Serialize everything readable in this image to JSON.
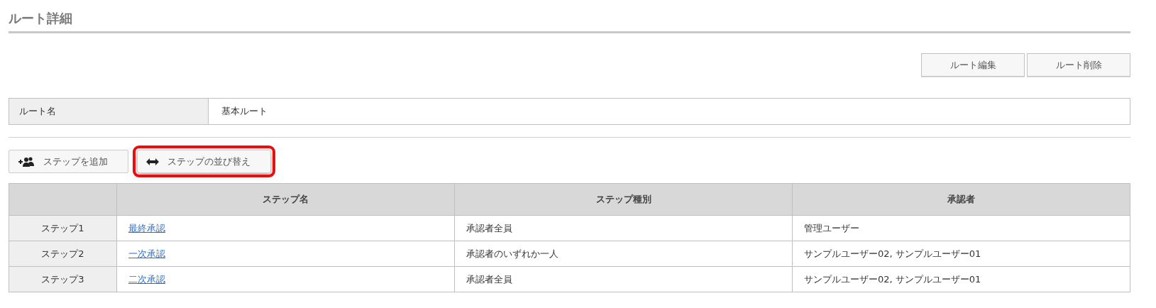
{
  "page_title": "ルート詳細",
  "actions": [
    {
      "label": "ルート編集"
    },
    {
      "label": "ルート削除"
    }
  ],
  "route_info": {
    "label": "ルート名",
    "value": "基本ルート"
  },
  "step_buttons": [
    {
      "kind": "add",
      "label": "ステップを追加",
      "highlighted": false
    },
    {
      "kind": "reorder",
      "label": "ステップの並び替え",
      "highlighted": true
    }
  ],
  "table": {
    "columns": [
      "ステップ名",
      "ステップ種別",
      "承認者"
    ],
    "rows": [
      {
        "step": "ステップ1",
        "name": "最終承認",
        "type": "承認者全員",
        "approvers": "管理ユーザー"
      },
      {
        "step": "ステップ2",
        "name": "一次承認",
        "type": "承認者のいずれか一人",
        "approvers": "サンプルユーザー02, サンプルユーザー01"
      },
      {
        "step": "ステップ3",
        "name": "二次承認",
        "type": "承認者全員",
        "approvers": "サンプルユーザー02, サンプルユーザー01"
      }
    ]
  }
}
